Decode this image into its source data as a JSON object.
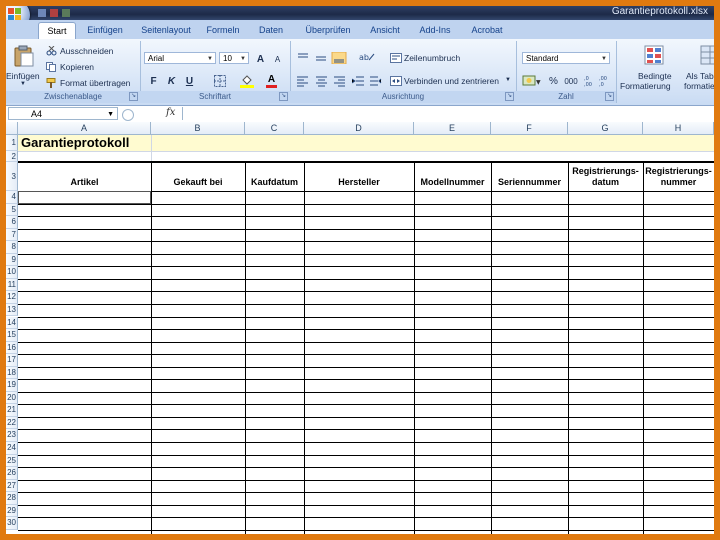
{
  "window": {
    "title": "Garantieprotokoll.xlsx"
  },
  "tabs": [
    {
      "label": "Start",
      "active": true
    },
    {
      "label": "Einfügen"
    },
    {
      "label": "Seitenlayout"
    },
    {
      "label": "Formeln"
    },
    {
      "label": "Daten"
    },
    {
      "label": "Überprüfen"
    },
    {
      "label": "Ansicht"
    },
    {
      "label": "Add-Ins"
    },
    {
      "label": "Acrobat"
    }
  ],
  "ribbon": {
    "clipboard": {
      "paste_label": "Einfügen",
      "cut_label": "Ausschneiden",
      "copy_label": "Kopieren",
      "format_painter_label": "Format übertragen",
      "group_label": "Zwischenablage"
    },
    "font": {
      "font_name": "Arial",
      "font_size": "10",
      "bold": "F",
      "italic": "K",
      "underline": "U",
      "grow": "A",
      "shrink": "A",
      "font_color_glyph": "A",
      "group_label": "Schriftart"
    },
    "alignment": {
      "wrap_label": "Zeilenumbruch",
      "merge_label": "Verbinden und zentrieren",
      "group_label": "Ausrichtung"
    },
    "number": {
      "format": "Standard",
      "percent": "%",
      "thousands": "000",
      "group_label": "Zahl"
    },
    "styles": {
      "conditional_label_1": "Bedingte",
      "conditional_label_2": "Formatierung",
      "table_label_1": "Als Tab",
      "table_label_2": "formatie"
    }
  },
  "formula_bar": {
    "name_box": "A4",
    "fx": "fx",
    "content": ""
  },
  "sheet": {
    "columns": [
      "A",
      "B",
      "C",
      "D",
      "E",
      "F",
      "G",
      "H"
    ],
    "row_numbers": [
      "1",
      "2",
      "3",
      "4",
      "5",
      "6",
      "7",
      "8",
      "9",
      "10",
      "11",
      "12",
      "13",
      "14",
      "15",
      "16",
      "17",
      "18",
      "19",
      "20",
      "21",
      "22",
      "23",
      "24",
      "25",
      "26",
      "27",
      "28",
      "29",
      "30"
    ],
    "title": "Garantieprotokoll",
    "headers": [
      "Artikel",
      "Gekauft bei",
      "Kaufdatum",
      "Hersteller",
      "Modellnummer",
      "Seriennummer",
      "Registrierungs-datum",
      "Registrierungs-nummer"
    ],
    "accent_color": "#e07a10",
    "title_fill": "#fffbd0"
  }
}
